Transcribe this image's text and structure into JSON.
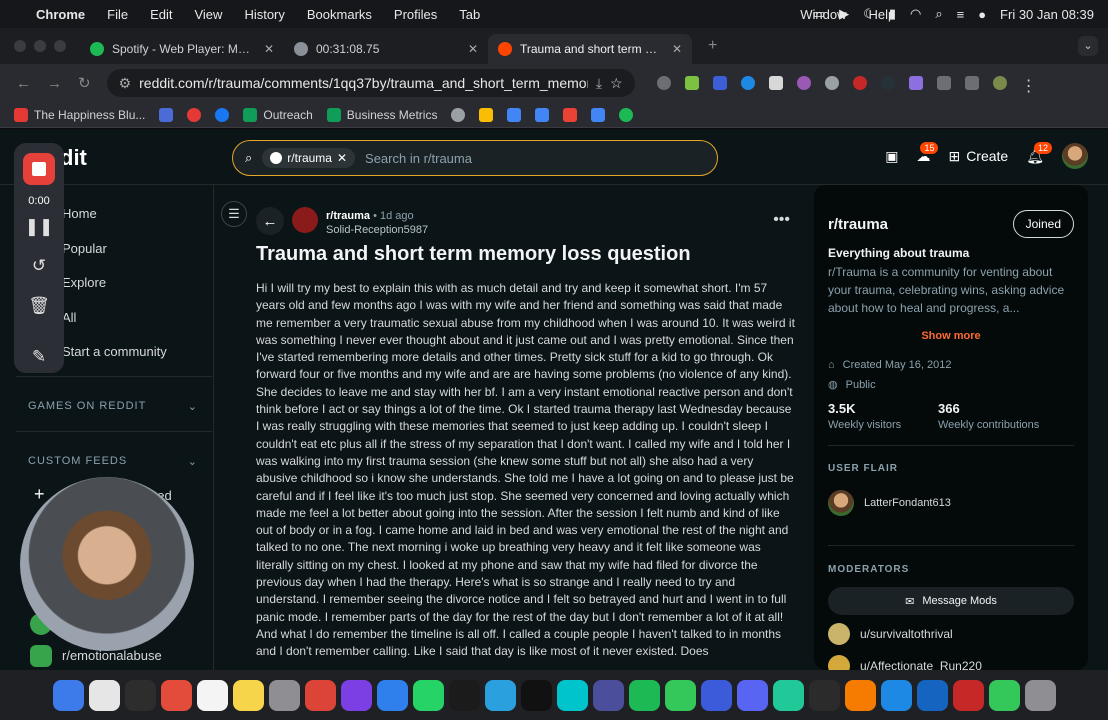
{
  "menubar": {
    "app": "Chrome",
    "items": [
      "File",
      "Edit",
      "View",
      "History",
      "Bookmarks",
      "Profiles",
      "Tab"
    ],
    "right_items": [
      "Window",
      "Help"
    ],
    "datetime": "Fri 30 Jan  08:39"
  },
  "tabs": [
    {
      "title": "Spotify - Web Player: Music f",
      "color": "#1db954"
    },
    {
      "title": "00:31:08.75",
      "color": "#8a8f98"
    },
    {
      "title": "Trauma and short term memo",
      "color": "#ff4500"
    }
  ],
  "new_tab": "+",
  "url": "reddit.com/r/trauma/comments/1qq37by/trauma_and_short_term_memory_...",
  "bookmarks": [
    {
      "label": "The Happiness Blu...",
      "color": "#e53935"
    },
    {
      "label": "",
      "color": "#4b6cd6"
    },
    {
      "label": "",
      "color": "#e53935"
    },
    {
      "label": "",
      "color": "#1877f2"
    },
    {
      "label": "Outreach",
      "color": "#0f9d58"
    },
    {
      "label": "Business Metrics",
      "color": "#0f9d58"
    },
    {
      "label": "",
      "color": "#9aa0a6"
    },
    {
      "label": "",
      "color": "#fbbc04"
    },
    {
      "label": "",
      "color": "#4285f4"
    },
    {
      "label": "",
      "color": "#4285f4"
    },
    {
      "label": "",
      "color": "#ea4335"
    },
    {
      "label": "",
      "color": "#4285f4"
    },
    {
      "label": "",
      "color": "#1db954"
    }
  ],
  "reddit": {
    "logo": "dit",
    "search": {
      "chip": "r/trauma",
      "placeholder": "Search in r/trauma"
    },
    "header": {
      "chat_badge": "15",
      "create": "Create",
      "notif_badge": "12"
    },
    "nav": {
      "home": "Home",
      "popular": "Popular",
      "explore": "Explore",
      "all": "All",
      "start": "Start a community",
      "games": "GAMES ON REDDIT",
      "feeds": "CUSTOM FEEDS",
      "create_feed": "eed",
      "community": "r/emotionalabuse"
    },
    "recorder": {
      "time": "0:00"
    },
    "post": {
      "subreddit": "r/trauma",
      "age": "• 1d ago",
      "author": "Solid-Reception5987",
      "title": "Trauma and short term memory loss question",
      "body": "Hi I will try my best to explain this with as much detail and try and keep it somewhat short. I'm 57 years old and few months ago I was with my wife and her friend and something was said that made me remember a very traumatic sexual abuse from my childhood when I was around 10. It was weird it was something I never ever thought about and it just came out and I was pretty emotional. Since then I've started remembering more details and other times. Pretty sick stuff for a kid to go through. Ok forward four or five months and my wife and are are having some problems (no violence of any kind). She decides to leave me and stay with her bf. I am a very instant emotional reactive person and don't think before I act or say things a lot of the time. Ok I started trauma therapy last Wednesday because I was really struggling with these memories that seemed to just keep adding up. I couldn't sleep I couldn't eat etc plus all if the stress of my separation that I don't want. I called my wife and I told her I was walking into my first trauma session (she knew some stuff but not all) she also had a very abusive childhood so i know she understands. She told me I have a lot going on and to please just be careful and if I feel like it's too much just stop. She seemed very concerned and loving actually which made me feel a lot better about going into the session. After the session I felt numb and kind of like out of body or in a fog. I came home and laid in bed and was very emotional the rest of the night and talked to no one. The next morning i woke up breathing very heavy and it felt like someone was literally sitting on my chest. I looked at my phone and saw that my wife had filed for divorce the previous day when I had the therapy. Here's what is so strange and I really need to try and understand. I remember seeing the divorce notice and I felt so betrayed and hurt and I went in to full panic mode. I remember parts of the day for the rest of the day but I don't remember a lot of it at all! And what I do remember the timeline is all off. I called a couple people I haven't talked to in months and I don't remember calling. Like I said that day is like most of it never existed. Does"
    },
    "sidebar": {
      "name": "r/trauma",
      "joined": "Joined",
      "tagline": "Everything about trauma",
      "description": "r/Trauma is a community for venting about your trauma, celebrating wins, asking advice about how to heal and progress, a...",
      "show_more": "Show more",
      "created": "Created May 16, 2012",
      "visibility": "Public",
      "visitors": "3.5K",
      "visitors_label": "Weekly visitors",
      "contribs": "366",
      "contribs_label": "Weekly contributions",
      "user_flair": "USER FLAIR",
      "flair_user": "LatterFondant613",
      "moderators": "MODERATORS",
      "message_mods": "Message Mods",
      "mods": [
        "u/survivaltothrival",
        "u/Affectionate_Run220"
      ]
    }
  },
  "dock": {
    "colors": [
      "#3d7bea",
      "#e6e6e6",
      "#2d2d2d",
      "#e34c3b",
      "#f4f4f4",
      "#f6d54a",
      "#8e8e93",
      "#db4437",
      "#7b3fe4",
      "#2f80ed",
      "#25d366",
      "#1b1b1b",
      "#2aa1de",
      "#111111",
      "#00c4cc",
      "#4b4f9b",
      "#1db954",
      "#34c759",
      "#3b5bdb",
      "#5865f2",
      "#20c997",
      "#2b2b2b",
      "#f57c00",
      "#1e88e5",
      "#1565c0",
      "#c62828",
      "#34c759",
      "#8e8e93"
    ]
  }
}
